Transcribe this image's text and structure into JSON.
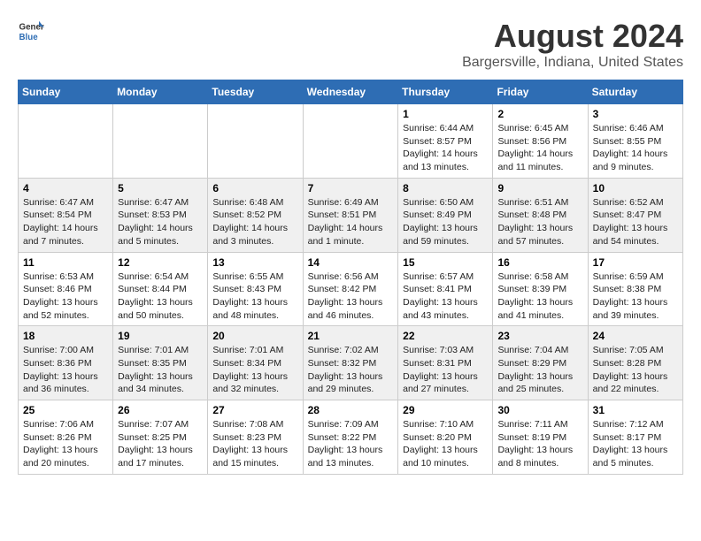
{
  "logo": {
    "general": "General",
    "blue": "Blue"
  },
  "title": "August 2024",
  "subtitle": "Bargersville, Indiana, United States",
  "days_of_week": [
    "Sunday",
    "Monday",
    "Tuesday",
    "Wednesday",
    "Thursday",
    "Friday",
    "Saturday"
  ],
  "weeks": [
    [
      {
        "day": "",
        "info": ""
      },
      {
        "day": "",
        "info": ""
      },
      {
        "day": "",
        "info": ""
      },
      {
        "day": "",
        "info": ""
      },
      {
        "day": "1",
        "info": "Sunrise: 6:44 AM\nSunset: 8:57 PM\nDaylight: 14 hours\nand 13 minutes."
      },
      {
        "day": "2",
        "info": "Sunrise: 6:45 AM\nSunset: 8:56 PM\nDaylight: 14 hours\nand 11 minutes."
      },
      {
        "day": "3",
        "info": "Sunrise: 6:46 AM\nSunset: 8:55 PM\nDaylight: 14 hours\nand 9 minutes."
      }
    ],
    [
      {
        "day": "4",
        "info": "Sunrise: 6:47 AM\nSunset: 8:54 PM\nDaylight: 14 hours\nand 7 minutes."
      },
      {
        "day": "5",
        "info": "Sunrise: 6:47 AM\nSunset: 8:53 PM\nDaylight: 14 hours\nand 5 minutes."
      },
      {
        "day": "6",
        "info": "Sunrise: 6:48 AM\nSunset: 8:52 PM\nDaylight: 14 hours\nand 3 minutes."
      },
      {
        "day": "7",
        "info": "Sunrise: 6:49 AM\nSunset: 8:51 PM\nDaylight: 14 hours\nand 1 minute."
      },
      {
        "day": "8",
        "info": "Sunrise: 6:50 AM\nSunset: 8:49 PM\nDaylight: 13 hours\nand 59 minutes."
      },
      {
        "day": "9",
        "info": "Sunrise: 6:51 AM\nSunset: 8:48 PM\nDaylight: 13 hours\nand 57 minutes."
      },
      {
        "day": "10",
        "info": "Sunrise: 6:52 AM\nSunset: 8:47 PM\nDaylight: 13 hours\nand 54 minutes."
      }
    ],
    [
      {
        "day": "11",
        "info": "Sunrise: 6:53 AM\nSunset: 8:46 PM\nDaylight: 13 hours\nand 52 minutes."
      },
      {
        "day": "12",
        "info": "Sunrise: 6:54 AM\nSunset: 8:44 PM\nDaylight: 13 hours\nand 50 minutes."
      },
      {
        "day": "13",
        "info": "Sunrise: 6:55 AM\nSunset: 8:43 PM\nDaylight: 13 hours\nand 48 minutes."
      },
      {
        "day": "14",
        "info": "Sunrise: 6:56 AM\nSunset: 8:42 PM\nDaylight: 13 hours\nand 46 minutes."
      },
      {
        "day": "15",
        "info": "Sunrise: 6:57 AM\nSunset: 8:41 PM\nDaylight: 13 hours\nand 43 minutes."
      },
      {
        "day": "16",
        "info": "Sunrise: 6:58 AM\nSunset: 8:39 PM\nDaylight: 13 hours\nand 41 minutes."
      },
      {
        "day": "17",
        "info": "Sunrise: 6:59 AM\nSunset: 8:38 PM\nDaylight: 13 hours\nand 39 minutes."
      }
    ],
    [
      {
        "day": "18",
        "info": "Sunrise: 7:00 AM\nSunset: 8:36 PM\nDaylight: 13 hours\nand 36 minutes."
      },
      {
        "day": "19",
        "info": "Sunrise: 7:01 AM\nSunset: 8:35 PM\nDaylight: 13 hours\nand 34 minutes."
      },
      {
        "day": "20",
        "info": "Sunrise: 7:01 AM\nSunset: 8:34 PM\nDaylight: 13 hours\nand 32 minutes."
      },
      {
        "day": "21",
        "info": "Sunrise: 7:02 AM\nSunset: 8:32 PM\nDaylight: 13 hours\nand 29 minutes."
      },
      {
        "day": "22",
        "info": "Sunrise: 7:03 AM\nSunset: 8:31 PM\nDaylight: 13 hours\nand 27 minutes."
      },
      {
        "day": "23",
        "info": "Sunrise: 7:04 AM\nSunset: 8:29 PM\nDaylight: 13 hours\nand 25 minutes."
      },
      {
        "day": "24",
        "info": "Sunrise: 7:05 AM\nSunset: 8:28 PM\nDaylight: 13 hours\nand 22 minutes."
      }
    ],
    [
      {
        "day": "25",
        "info": "Sunrise: 7:06 AM\nSunset: 8:26 PM\nDaylight: 13 hours\nand 20 minutes."
      },
      {
        "day": "26",
        "info": "Sunrise: 7:07 AM\nSunset: 8:25 PM\nDaylight: 13 hours\nand 17 minutes."
      },
      {
        "day": "27",
        "info": "Sunrise: 7:08 AM\nSunset: 8:23 PM\nDaylight: 13 hours\nand 15 minutes."
      },
      {
        "day": "28",
        "info": "Sunrise: 7:09 AM\nSunset: 8:22 PM\nDaylight: 13 hours\nand 13 minutes."
      },
      {
        "day": "29",
        "info": "Sunrise: 7:10 AM\nSunset: 8:20 PM\nDaylight: 13 hours\nand 10 minutes."
      },
      {
        "day": "30",
        "info": "Sunrise: 7:11 AM\nSunset: 8:19 PM\nDaylight: 13 hours\nand 8 minutes."
      },
      {
        "day": "31",
        "info": "Sunrise: 7:12 AM\nSunset: 8:17 PM\nDaylight: 13 hours\nand 5 minutes."
      }
    ]
  ]
}
